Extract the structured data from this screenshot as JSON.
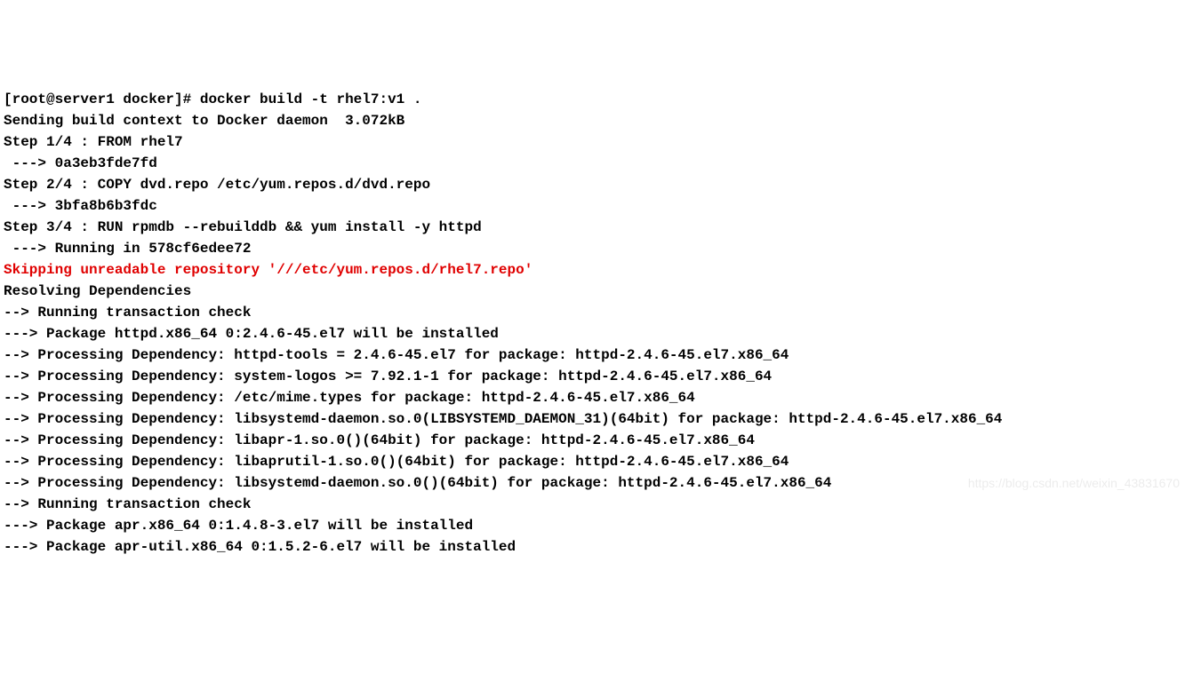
{
  "terminal": {
    "lines": [
      {
        "text": "[root@server1 docker]# docker build -t rhel7:v1 .",
        "color": "default"
      },
      {
        "text": "Sending build context to Docker daemon  3.072kB",
        "color": "default"
      },
      {
        "text": "Step 1/4 : FROM rhel7",
        "color": "default"
      },
      {
        "text": " ---> 0a3eb3fde7fd",
        "color": "default"
      },
      {
        "text": "Step 2/4 : COPY dvd.repo /etc/yum.repos.d/dvd.repo",
        "color": "default"
      },
      {
        "text": " ---> 3bfa8b6b3fdc",
        "color": "default"
      },
      {
        "text": "Step 3/4 : RUN rpmdb --rebuilddb && yum install -y httpd",
        "color": "default"
      },
      {
        "text": " ---> Running in 578cf6edee72",
        "color": "default"
      },
      {
        "text": "Skipping unreadable repository '///etc/yum.repos.d/rhel7.repo'",
        "color": "red"
      },
      {
        "text": "Resolving Dependencies",
        "color": "default"
      },
      {
        "text": "--> Running transaction check",
        "color": "default"
      },
      {
        "text": "---> Package httpd.x86_64 0:2.4.6-45.el7 will be installed",
        "color": "default"
      },
      {
        "text": "--> Processing Dependency: httpd-tools = 2.4.6-45.el7 for package: httpd-2.4.6-45.el7.x86_64",
        "color": "default"
      },
      {
        "text": "--> Processing Dependency: system-logos >= 7.92.1-1 for package: httpd-2.4.6-45.el7.x86_64",
        "color": "default"
      },
      {
        "text": "--> Processing Dependency: /etc/mime.types for package: httpd-2.4.6-45.el7.x86_64",
        "color": "default"
      },
      {
        "text": "--> Processing Dependency: libsystemd-daemon.so.0(LIBSYSTEMD_DAEMON_31)(64bit) for package: httpd-2.4.6-45.el7.x86_64",
        "color": "default"
      },
      {
        "text": "--> Processing Dependency: libapr-1.so.0()(64bit) for package: httpd-2.4.6-45.el7.x86_64",
        "color": "default"
      },
      {
        "text": "--> Processing Dependency: libaprutil-1.so.0()(64bit) for package: httpd-2.4.6-45.el7.x86_64",
        "color": "default"
      },
      {
        "text": "--> Processing Dependency: libsystemd-daemon.so.0()(64bit) for package: httpd-2.4.6-45.el7.x86_64",
        "color": "default"
      },
      {
        "text": "--> Running transaction check",
        "color": "default"
      },
      {
        "text": "---> Package apr.x86_64 0:1.4.8-3.el7 will be installed",
        "color": "default"
      },
      {
        "text": "---> Package apr-util.x86_64 0:1.5.2-6.el7 will be installed",
        "color": "default"
      }
    ]
  },
  "watermark": "https://blog.csdn.net/weixin_43831670"
}
